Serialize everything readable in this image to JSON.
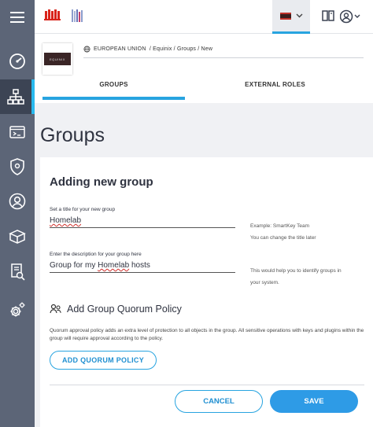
{
  "sidebar": {
    "items": [
      {
        "icon": "menu-icon"
      },
      {
        "icon": "dashboard-icon"
      },
      {
        "icon": "groups-hierarchy-icon",
        "active": true
      },
      {
        "icon": "apps-console-icon"
      },
      {
        "icon": "security-shield-icon"
      },
      {
        "icon": "user-icon"
      },
      {
        "icon": "box-plugins-icon"
      },
      {
        "icon": "audit-log-icon"
      },
      {
        "icon": "settings-gear-icon"
      }
    ]
  },
  "header": {
    "logo1": "equinix-logo",
    "logo2": "fortanix-logo",
    "tenant_flag_colors": [
      "#c0322b",
      "#3b1d1d"
    ]
  },
  "breadcrumb": "EUROPEAN UNION  / Equinix / Groups / New",
  "thumbnail_label": "EQUINIX",
  "tabs": [
    {
      "label": "GROUPS",
      "active": true
    },
    {
      "label": "EXTERNAL ROLES",
      "active": false
    }
  ],
  "page_title": "Groups",
  "form": {
    "heading": "Adding new group",
    "title_label": "Set a title for your new group",
    "title_value_1": "Homelab",
    "title_hint_1": "Example: SmartKey Team",
    "title_hint_2": "You can change the title later",
    "desc_label": "Enter the description for your group here",
    "desc_value_pre": "Group for my ",
    "desc_value_mid": "Homelab",
    "desc_value_post": " hosts",
    "desc_hint_1": "This would help you to identify groups in",
    "desc_hint_2": "your system.",
    "quorum_title": "Add Group Quorum Policy",
    "quorum_desc": "Quorum approval policy adds an extra level of protection to all objects in the group. All sensitive operations with keys and plugins within the group will require approval according to the policy.",
    "quorum_button": "ADD QUORUM POLICY",
    "cancel_button": "CANCEL",
    "save_button": "SAVE"
  },
  "colors": {
    "accent": "#28a4e0",
    "sidebar": "#5c6577",
    "save": "#2e9be6"
  }
}
